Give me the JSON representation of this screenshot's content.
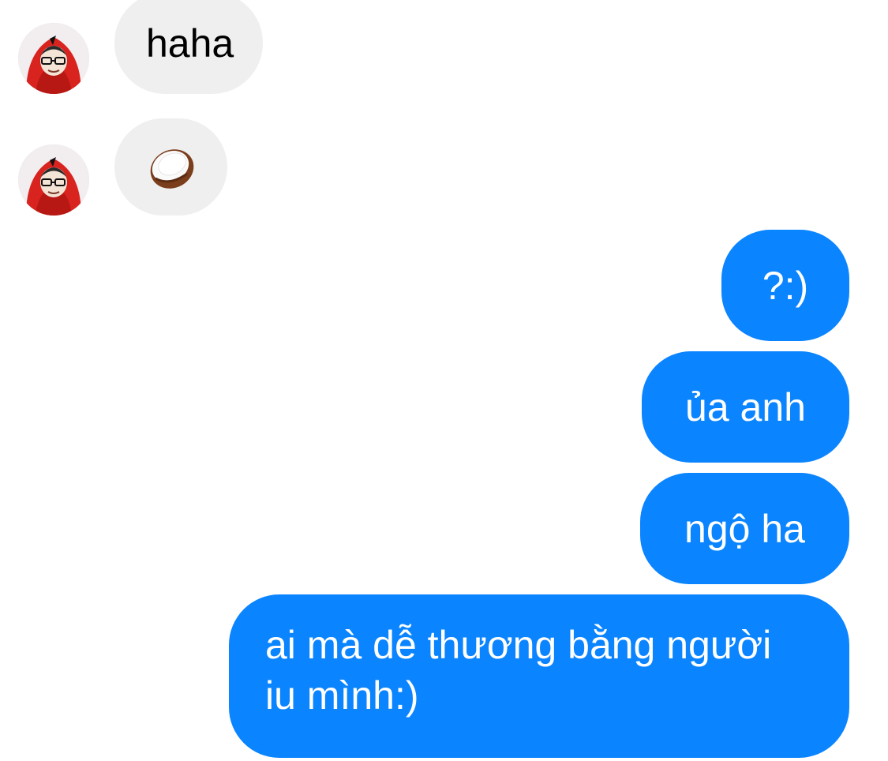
{
  "conversation": {
    "messages": [
      {
        "direction": "incoming",
        "text": "haha"
      },
      {
        "direction": "incoming",
        "emoji": "coconut"
      },
      {
        "direction": "outgoing",
        "text": "?:)"
      },
      {
        "direction": "outgoing",
        "text": "ủa anh"
      },
      {
        "direction": "outgoing",
        "text": "ngộ ha"
      },
      {
        "direction": "outgoing",
        "text": "ai mà dễ thương bằng người iu mình:)"
      }
    ]
  },
  "colors": {
    "outgoing_bubble": "#0a84ff",
    "incoming_bubble": "#efefef"
  },
  "icons": {
    "avatar": "contact-avatar",
    "emoji": "coconut-icon"
  }
}
